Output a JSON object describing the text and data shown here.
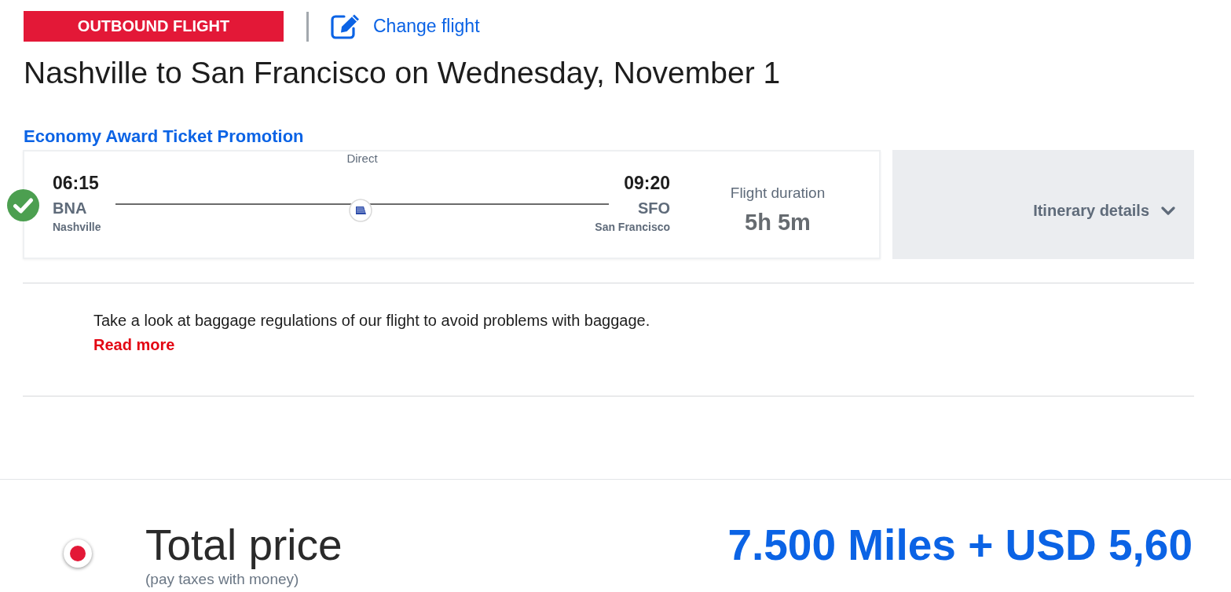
{
  "header": {
    "badge": "OUTBOUND FLIGHT",
    "change_link": "Change flight"
  },
  "title": "Nashville to San Francisco on Wednesday, November 1",
  "fare": {
    "name": "Economy Award Ticket Promotion"
  },
  "flight": {
    "selected": true,
    "stops": "Direct",
    "departure": {
      "time": "06:15",
      "code": "BNA",
      "city": "Nashville"
    },
    "arrival": {
      "time": "09:20",
      "code": "SFO",
      "city": "San Francisco"
    },
    "duration_label": "Flight duration",
    "duration": "5h 5m"
  },
  "itinerary": {
    "label": "Itinerary details",
    "expanded": false
  },
  "baggage_notice": {
    "text": "Take a look at baggage regulations of our flight to avoid problems with baggage.",
    "link": "Read more"
  },
  "price_option": {
    "selected": true,
    "label": "Total price",
    "note": "(pay taxes with money)",
    "amount": "7.500 Miles + USD 5,60"
  }
}
